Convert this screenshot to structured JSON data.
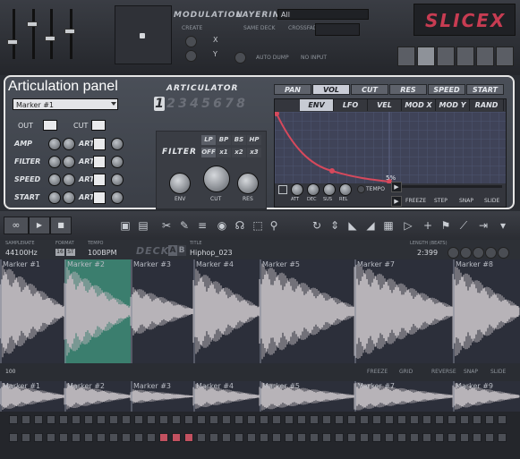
{
  "app": {
    "logo": "SLICEX"
  },
  "top": {
    "modulation_label": "MODULATION",
    "layering_label": "LAYERING",
    "layer_select": "All",
    "create_label": "CREATE",
    "same_deck_label": "SAME DECK",
    "crossfade_label": "CROSSFADE",
    "auto_dump_label": "AUTO DUMP",
    "no_input_label": "NO INPUT",
    "x_label": "X",
    "y_label": "Y"
  },
  "callout": {
    "label": "Articulation panel"
  },
  "articulator": {
    "title": "ARTICULATOR",
    "marker_select": "Marker #1",
    "numbers": [
      "1",
      "2",
      "3",
      "4",
      "5",
      "6",
      "7",
      "8"
    ],
    "active_number": "1",
    "out_label": "OUT",
    "cut_label": "CUT",
    "rows": [
      {
        "label": "AMP",
        "art": "ART"
      },
      {
        "label": "FILTER",
        "art": "ART"
      },
      {
        "label": "SPEED",
        "art": "ART"
      },
      {
        "label": "START",
        "art": "ART"
      }
    ],
    "filter": {
      "label": "FILTER",
      "types": [
        "LP",
        "BP",
        "BS",
        "HP"
      ],
      "modes": [
        "OFF",
        "x1",
        "x2",
        "x3"
      ],
      "knobs": [
        "ENV",
        "CUT",
        "RES"
      ]
    },
    "targets": [
      "PAN",
      "VOL",
      "CUT",
      "RES",
      "SPEED",
      "START"
    ],
    "active_target": "VOL",
    "env_tabs": [
      "ENV",
      "LFO",
      "VEL",
      "MOD X",
      "MOD Y",
      "RAND"
    ],
    "active_env_tab": "ENV",
    "env_value": "5%",
    "env_knobs": [
      "ATT",
      "DEC",
      "SUS",
      "REL"
    ],
    "tempo_label": "TEMPO",
    "freeze_label": "FREEZE",
    "step_label": "STEP",
    "snap_label": "SNAP",
    "slide_label": "SLIDE"
  },
  "deck": {
    "samplerate_label": "SAMPLERATE",
    "samplerate": "44100Hz",
    "format_label": "FORMAT",
    "format_16": "16",
    "format_st": "ST",
    "tempo_label": "TEMPO",
    "tempo": "100BPM",
    "deck_label": "DECK",
    "deck_a": "A",
    "deck_b": "B",
    "title_label": "TITLE",
    "title": "Hiphop_023",
    "length_label": "LENGTH (BEATS)",
    "length": "2:399",
    "markers": [
      "Marker #1",
      "Marker #2",
      "Marker #3",
      "Marker #4",
      "Marker #5",
      "Marker #7",
      "Marker #8"
    ],
    "markers_overview": [
      "Marker #1",
      "Marker #2",
      "Marker #3",
      "Marker #4",
      "Marker #5",
      "Marker #7",
      "Marker #9"
    ],
    "freeze_label": "FREEZE",
    "grid_label": "GRID",
    "reverse_label": "REVERSE",
    "snap_label": "SNAP",
    "slide_label": "SLIDE",
    "zoom_label": "100"
  },
  "colors": {
    "accent": "#c7485a",
    "bg": "#2a2d33",
    "wave": "#b7b3b8",
    "highlight": "#3b7e6e"
  }
}
